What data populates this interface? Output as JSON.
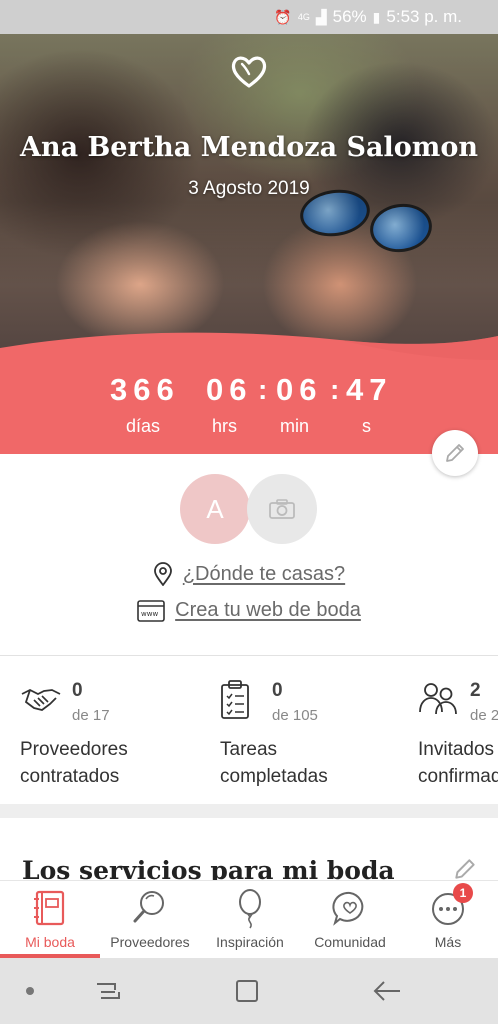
{
  "status_bar": {
    "network": "4G",
    "battery": "56%",
    "time": "5:53 p. m."
  },
  "hero": {
    "couple_name": "Ana Bertha Mendoza Salomon",
    "date": "3 Agosto 2019"
  },
  "countdown": {
    "days": "366",
    "days_label": "días",
    "hours": "06",
    "hours_label": "hrs",
    "minutes": "06",
    "minutes_label": "min",
    "seconds": "47",
    "seconds_label": "s",
    "separator": ":"
  },
  "profile": {
    "avatar_initial": "A",
    "where_link": "¿Dónde te casas?",
    "web_link": "Crea tu web de boda"
  },
  "stats": [
    {
      "value": "0",
      "total": "de 17",
      "label_line1": "Proveedores",
      "label_line2": "contratados",
      "icon": "handshake-icon"
    },
    {
      "value": "0",
      "total": "de 105",
      "label_line1": "Tareas",
      "label_line2": "completadas",
      "icon": "clipboard-icon"
    },
    {
      "value": "2",
      "total": "de 2",
      "label_line1": "Invitados",
      "label_line2": "confirmados",
      "icon": "guests-icon"
    }
  ],
  "section": {
    "title": "Los servicios para mi boda"
  },
  "bottom_nav": [
    {
      "label": "Mi boda",
      "icon": "notebook-icon",
      "active": true
    },
    {
      "label": "Proveedores",
      "icon": "magnifier-icon"
    },
    {
      "label": "Inspiración",
      "icon": "balloon-icon"
    },
    {
      "label": "Comunidad",
      "icon": "chat-heart-icon"
    },
    {
      "label": "Más",
      "icon": "more-icon",
      "badge": "1"
    }
  ],
  "colors": {
    "accent": "#e85a5a",
    "wave": "#f06868",
    "text": "#333333"
  }
}
